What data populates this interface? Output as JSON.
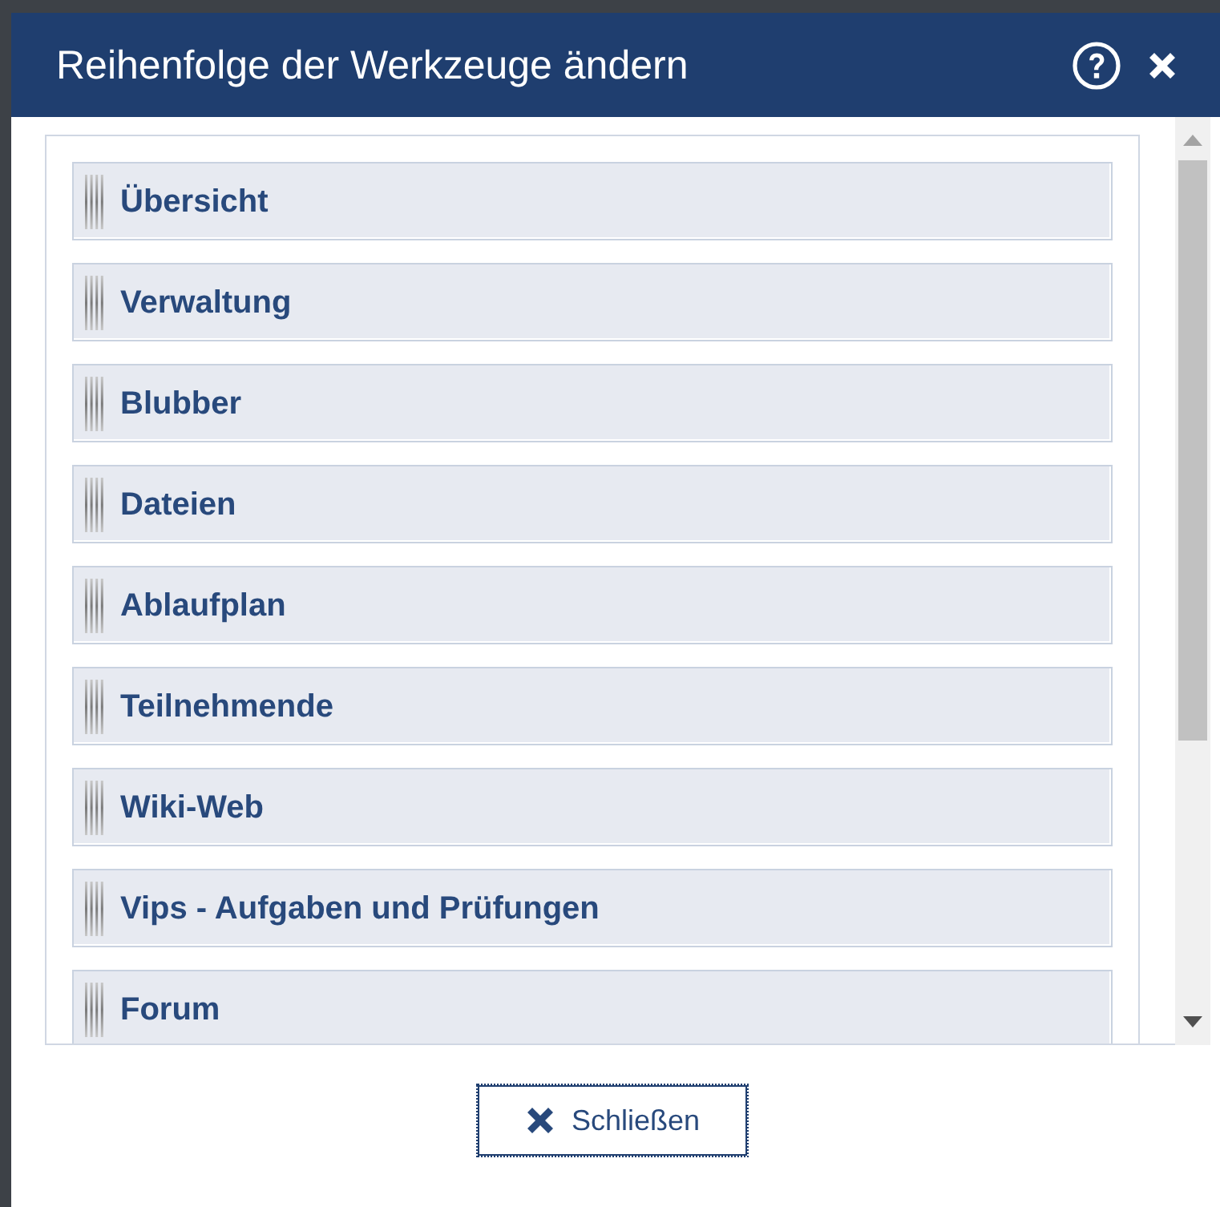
{
  "dialog": {
    "title": "Reihenfolge der Werkzeuge ändern"
  },
  "tools": [
    {
      "label": "Übersicht"
    },
    {
      "label": "Verwaltung"
    },
    {
      "label": "Blubber"
    },
    {
      "label": "Dateien"
    },
    {
      "label": "Ablaufplan"
    },
    {
      "label": "Teilnehmende"
    },
    {
      "label": "Wiki-Web"
    },
    {
      "label": "Vips - Aufgaben und Prüfungen"
    },
    {
      "label": "Forum"
    }
  ],
  "buttons": [
    {
      "label": "Schließen"
    }
  ]
}
